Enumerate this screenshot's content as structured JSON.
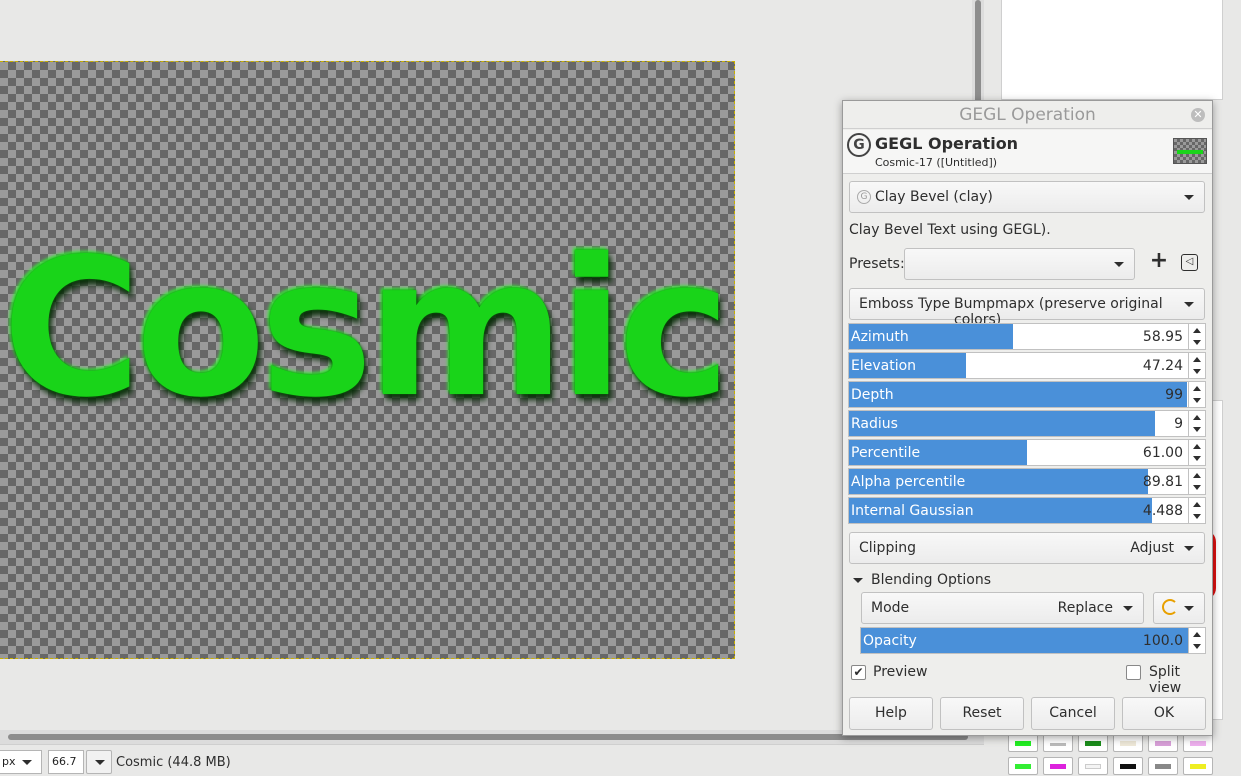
{
  "canvas": {
    "image_text": "Cosmic"
  },
  "statusbar": {
    "unit": "px",
    "zoom": "66.7 %",
    "image_info": "Cosmic (44.8 MB)"
  },
  "dialog": {
    "window_title": "GEGL Operation",
    "header_title": "GEGL Operation",
    "header_subtitle": "Cosmic-17 ([Untitled])",
    "close_icon": "close-icon",
    "operation": "Clay Bevel (clay)",
    "description": "Clay Bevel Text using GEGL).",
    "presets_label": "Presets:",
    "presets_value": "",
    "add_preset": "+",
    "emboss": {
      "label": "Emboss Type",
      "value": "Bumpmapx (preserve original colors)"
    },
    "params": [
      {
        "label": "Azimuth",
        "value": "58.95",
        "fill": 0.46
      },
      {
        "label": "Elevation",
        "value": "47.24",
        "fill": 0.33
      },
      {
        "label": "Depth",
        "value": "99",
        "fill": 0.95
      },
      {
        "label": "Radius",
        "value": "9",
        "fill": 0.86
      },
      {
        "label": "Percentile",
        "value": "61.00",
        "fill": 0.5
      },
      {
        "label": "Alpha percentile",
        "value": "89.81",
        "fill": 0.84
      },
      {
        "label": "Internal Gaussian",
        "value": "4.488",
        "fill": 0.85
      }
    ],
    "clipping": {
      "label": "Clipping",
      "value": "Adjust"
    },
    "blending": {
      "label": "Blending Options",
      "mode_label": "Mode",
      "mode_value": "Replace",
      "opacity_label": "Opacity",
      "opacity_value": "100.0",
      "opacity_fill": 1.0
    },
    "preview_label": "Preview",
    "preview_checked": true,
    "split_label": "Split view",
    "split_checked": false,
    "buttons": {
      "help": "Help",
      "reset": "Reset",
      "cancel": "Cancel",
      "ok": "OK"
    }
  },
  "colors": {
    "accent": "#4a90d9",
    "text_green": "#19d419"
  }
}
